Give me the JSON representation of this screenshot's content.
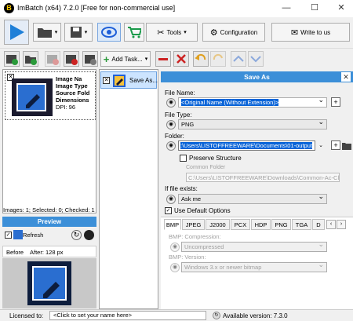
{
  "app": {
    "title": "ImBatch (x64) 7.2.0 [Free for non-commercial use]",
    "logo": "B"
  },
  "toolbar": {
    "tools_label": "Tools",
    "configuration_label": "Configuration",
    "write_label": "Write to us",
    "add_task_label": "Add Task..."
  },
  "image": {
    "name_label": "Image Na",
    "type_label": "Image Type",
    "source_label": "Source Fold",
    "dimensions_label": "Dimensions",
    "dpi_label": "DPI: 96"
  },
  "status": {
    "images_count": "Images: 1; Selected: 0; Checked: 1"
  },
  "preview": {
    "title": "Preview",
    "mode_label": "Refresh",
    "before_label": "Before",
    "after_label": "After: 128 px"
  },
  "task": {
    "save_as_label": "Save As..."
  },
  "save_as": {
    "header": "Save As",
    "file_name_label": "File Name:",
    "file_name_value": "<Original Name (Without Extension)>",
    "file_type_label": "File Type:",
    "file_type_value": "PNG",
    "folder_label": "Folder:",
    "folder_value": ":\\Users\\LISTOFFREEWARE\\Documents\\01-output",
    "preserve_label": "Preserve Structure",
    "common_folder_label": "Common Folder",
    "common_folder_value": "C:\\Users\\LISTOFFREEWARE\\Downloads\\Common-Ac-Closing",
    "if_exists_label": "If file exists:",
    "if_exists_value": "Ask me",
    "use_default_label": "Use Default Options",
    "tabs": [
      "BMP",
      "JPEG",
      "J2000",
      "PCX",
      "HDP",
      "PNG",
      "TGA",
      "D"
    ],
    "compression_label": "BMP: Compression:",
    "compression_value": "Uncompressed",
    "version_label": "BMP: Version:",
    "version_value": "Windows 3.x or newer bitmap"
  },
  "footer": {
    "licensed_label": "Licensed to:",
    "licensed_value": "<Click to set your name here>",
    "available_label": "Available version: 7.3.0"
  },
  "colors": {
    "accent": "#1e5fd8",
    "selected": "#cce4ff",
    "title_blue": "#3c8fd8"
  }
}
